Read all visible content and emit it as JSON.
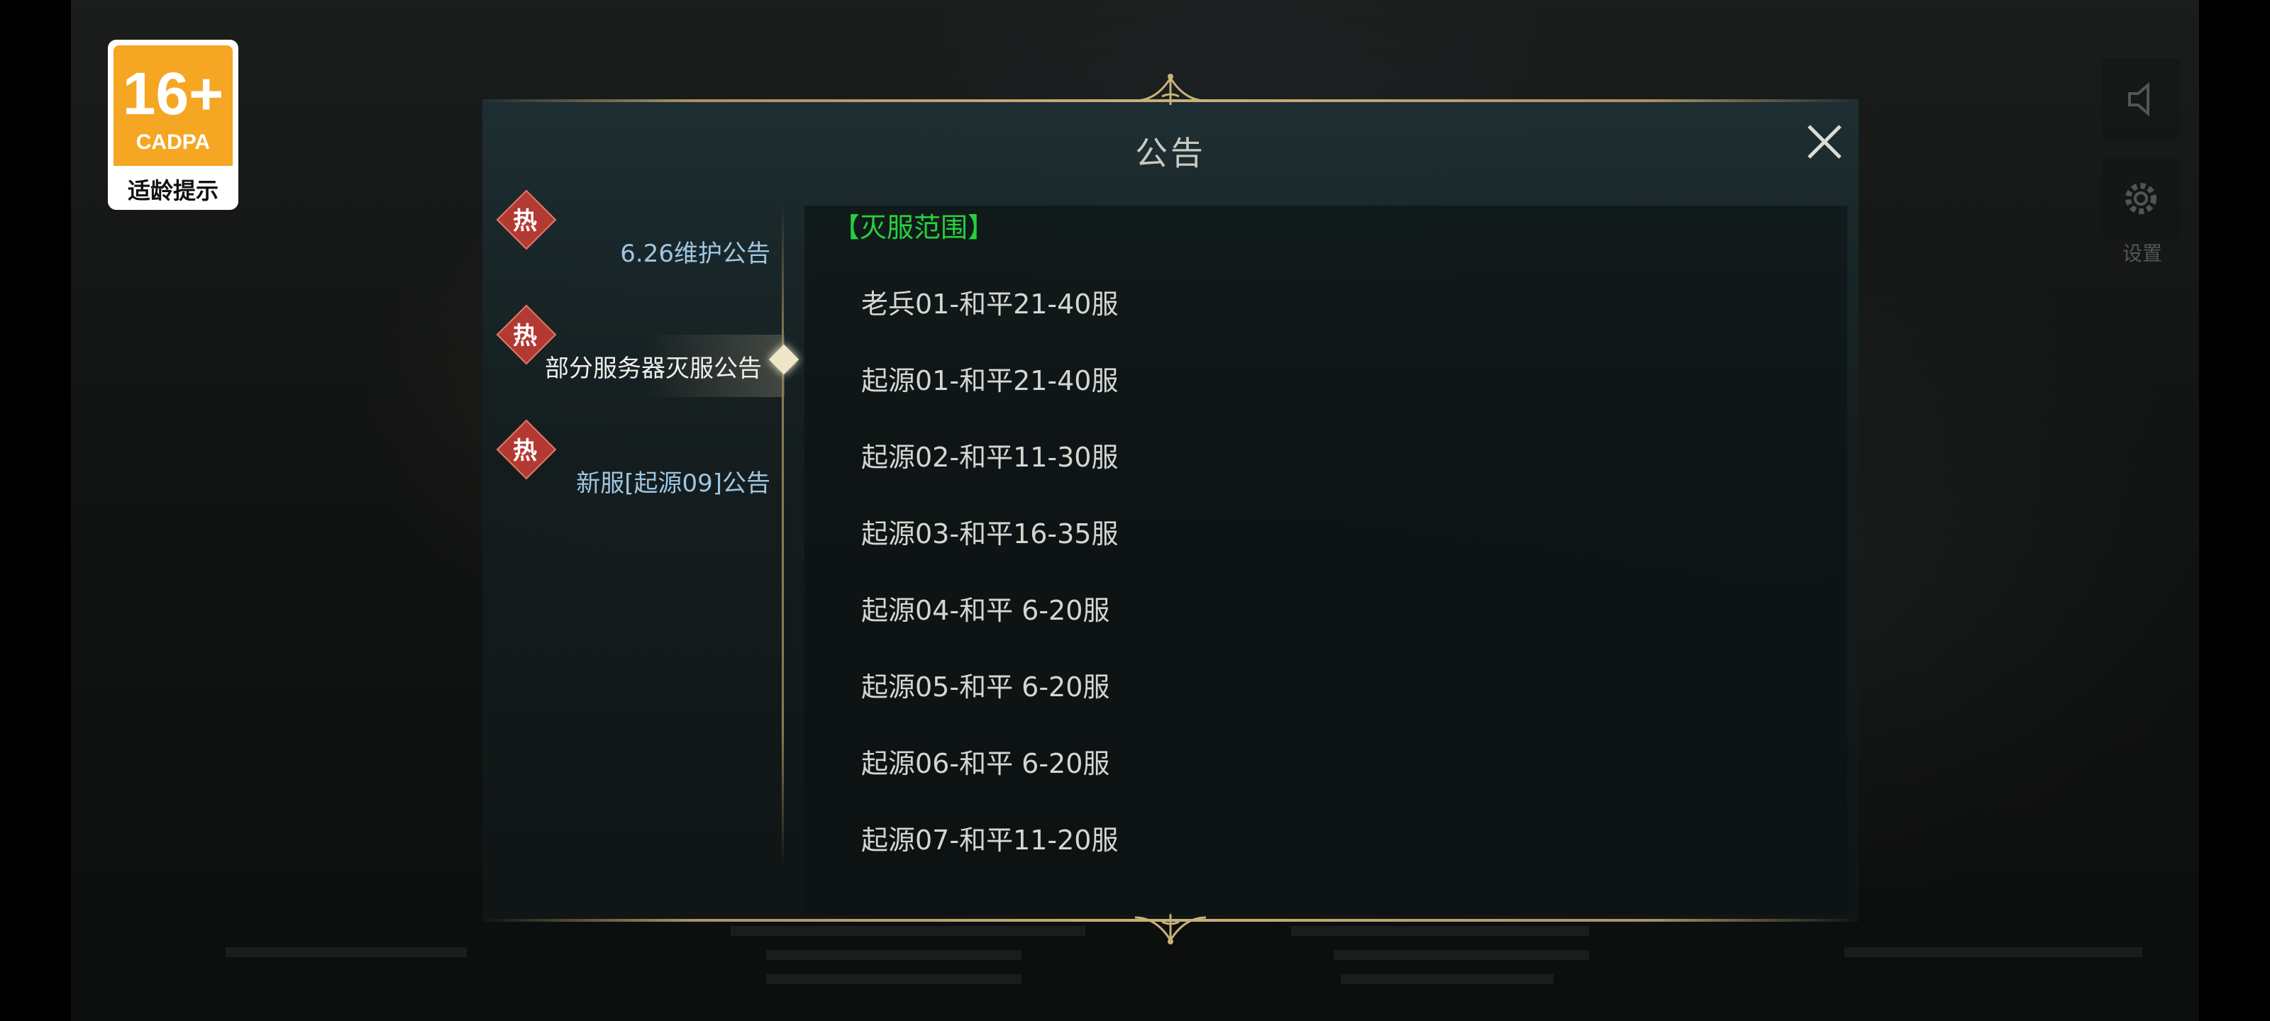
{
  "age_badge": {
    "rating": "16+",
    "org": "CADPA",
    "label": "适龄提示"
  },
  "side_icons": {
    "settings_label": "设置"
  },
  "modal": {
    "title": "公告",
    "tabs": [
      {
        "badge": "热",
        "label": "6.26维护公告",
        "active": false
      },
      {
        "badge": "热",
        "label": "部分服务器灭服公告",
        "active": true
      },
      {
        "badge": "热",
        "label": "新服[起源09]公告",
        "active": false
      }
    ],
    "content": {
      "heading": "【灭服范围】",
      "lines": [
        "老兵01-和平21-40服",
        "起源01-和平21-40服",
        "起源02-和平11-30服",
        "起源03-和平16-35服",
        "起源04-和平 6-20服",
        "起源05-和平 6-20服",
        "起源06-和平 6-20服",
        "起源07-和平11-20服"
      ]
    }
  },
  "colors": {
    "accent_gold": "#c9b27a",
    "heading_green": "#27d13c",
    "tab_blue": "#9fc6e2",
    "badge_red": "#b33a32",
    "age_orange": "#f5a623"
  }
}
